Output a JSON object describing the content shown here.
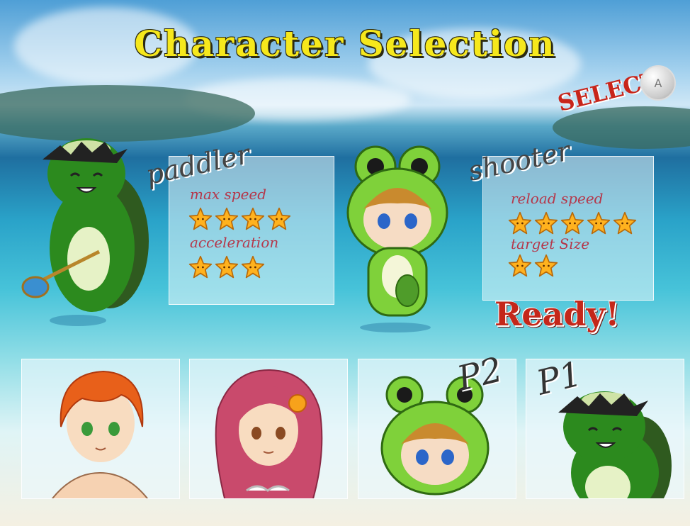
{
  "screen": {
    "title": "Character Selection",
    "select_prompt": "SELECT",
    "select_button": "A",
    "ready_text": "Ready!"
  },
  "player2_selection": {
    "role": "paddler",
    "stats": [
      {
        "label": "max speed",
        "stars": 4
      },
      {
        "label": "acceleration",
        "stars": 3
      }
    ]
  },
  "player1_selection": {
    "role": "shooter",
    "stats": [
      {
        "label": "reload speed",
        "stars": 5
      },
      {
        "label": "target Size",
        "stars": 2
      }
    ]
  },
  "roster": {
    "cards": [
      {
        "character": "red-haired-boy",
        "tag": ""
      },
      {
        "character": "pink-haired-girl",
        "tag": ""
      },
      {
        "character": "frog-hood-boy",
        "tag": "P2"
      },
      {
        "character": "turtle",
        "tag": "P1"
      }
    ]
  },
  "colors": {
    "title": "#f6e81c",
    "accent_red": "#c4271a",
    "stat_label": "#b5374a",
    "star": "#ffb21e"
  }
}
